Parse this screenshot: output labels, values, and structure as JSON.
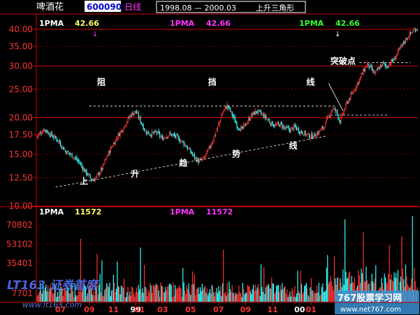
{
  "header": {
    "stock_name": "啤酒花",
    "stock_code": "600090",
    "period": "日线",
    "date_range": "1998.08 — 2000.03",
    "pattern_title": "上升三角形"
  },
  "price_panel": {
    "indicator_labels": [
      {
        "label": "1PMA",
        "value": "42.66",
        "color": "#ffffff"
      },
      {
        "label": "1PMA",
        "value": "42.66",
        "color": "#ff33ff"
      },
      {
        "label": "1PMA",
        "value": "42.66",
        "color": "#33ff33"
      }
    ],
    "annotations": [
      {
        "text": "阻",
        "x": 63,
        "y": 25.9
      },
      {
        "text": "挡",
        "x": 178,
        "y": 25.9
      },
      {
        "text": "线",
        "x": 280,
        "y": 25.9
      },
      {
        "text": "突破点",
        "x": 305,
        "y": 30.5
      },
      {
        "text": "上",
        "x": 45,
        "y": 11.9
      },
      {
        "text": "升",
        "x": 98,
        "y": 12.6
      },
      {
        "text": "趋",
        "x": 148,
        "y": 13.7
      },
      {
        "text": "势",
        "x": 203,
        "y": 14.7
      },
      {
        "text": "线",
        "x": 262,
        "y": 15.7
      }
    ]
  },
  "volume_panel": {
    "indicator_labels": [
      {
        "label": "1PMA",
        "value": "11572",
        "color": "#ffffff"
      },
      {
        "label": "1PMA",
        "value": "11572",
        "color": "#ff33ff"
      }
    ]
  },
  "watermarks": {
    "left_brand": "LT163 证券首席",
    "left_url": "www.lt163.com",
    "right_brand": "767股票学习网",
    "right_url": "www.net767.com"
  },
  "colors": {
    "up": "#ff3333",
    "down": "#33ffff",
    "axis": "#cc0000",
    "tick_text": "#ff3333",
    "resistance_line": "#ffffff",
    "trend_line": "#ffffff"
  },
  "chart_data": [
    {
      "type": "candlestick",
      "title": "",
      "y_scale": "log",
      "ylim": [
        10.0,
        40.0
      ],
      "y_ticks": [
        40.0,
        35.0,
        30.0,
        25.0,
        20.0,
        17.5,
        15.0,
        12.5,
        10.0
      ],
      "x_tick_labels": [
        {
          "label": "07",
          "x": 25
        },
        {
          "label": "09",
          "x": 55
        },
        {
          "label": "11",
          "x": 80
        },
        {
          "label": "99",
          "x": 103
        },
        {
          "label": "01",
          "x": 107
        },
        {
          "label": "03",
          "x": 131
        },
        {
          "label": "05",
          "x": 160
        },
        {
          "label": "07",
          "x": 189
        },
        {
          "label": "09",
          "x": 217
        },
        {
          "label": "11",
          "x": 245
        },
        {
          "label": "00",
          "x": 273
        },
        {
          "label": "01",
          "x": 285
        }
      ],
      "close_path": [
        [
          0,
          17.2
        ],
        [
          8,
          18.3
        ],
        [
          15,
          17.5
        ],
        [
          22,
          16.8
        ],
        [
          30,
          15.4
        ],
        [
          38,
          14.8
        ],
        [
          45,
          14.0
        ],
        [
          50,
          13.2
        ],
        [
          55,
          12.6
        ],
        [
          58,
          12.2
        ],
        [
          62,
          12.5
        ],
        [
          68,
          13.4
        ],
        [
          75,
          15.2
        ],
        [
          82,
          16.8
        ],
        [
          90,
          18.5
        ],
        [
          98,
          20.5
        ],
        [
          103,
          21.0
        ],
        [
          108,
          19.5
        ],
        [
          113,
          18.0
        ],
        [
          118,
          17.6
        ],
        [
          125,
          17.8
        ],
        [
          130,
          17.0
        ],
        [
          138,
          17.6
        ],
        [
          145,
          17.2
        ],
        [
          152,
          16.5
        ],
        [
          158,
          15.6
        ],
        [
          163,
          14.8
        ],
        [
          168,
          14.2
        ],
        [
          173,
          14.4
        ],
        [
          178,
          15.4
        ],
        [
          183,
          16.8
        ],
        [
          188,
          18.5
        ],
        [
          193,
          20.8
        ],
        [
          198,
          22.0
        ],
        [
          203,
          20.5
        ],
        [
          208,
          18.8
        ],
        [
          213,
          18.2
        ],
        [
          218,
          19.2
        ],
        [
          223,
          20.4
        ],
        [
          228,
          21.0
        ],
        [
          233,
          20.6
        ],
        [
          238,
          20.0
        ],
        [
          243,
          19.2
        ],
        [
          248,
          18.8
        ],
        [
          253,
          19.0
        ],
        [
          258,
          18.4
        ],
        [
          263,
          18.2
        ],
        [
          268,
          18.6
        ],
        [
          273,
          18.0
        ],
        [
          278,
          17.7
        ],
        [
          283,
          17.3
        ],
        [
          288,
          17.4
        ],
        [
          293,
          17.9
        ],
        [
          298,
          18.6
        ],
        [
          303,
          20.2
        ],
        [
          307,
          21.5
        ],
        [
          311,
          21.0
        ],
        [
          315,
          19.4
        ],
        [
          319,
          21.2
        ],
        [
          323,
          22.8
        ],
        [
          327,
          24.0
        ],
        [
          331,
          25.5
        ],
        [
          335,
          27.0
        ],
        [
          339,
          28.8
        ],
        [
          343,
          30.4
        ],
        [
          347,
          29.3
        ],
        [
          351,
          28.2
        ],
        [
          355,
          29.4
        ],
        [
          359,
          30.6
        ],
        [
          363,
          29.8
        ],
        [
          367,
          30.8
        ],
        [
          371,
          31.6
        ],
        [
          375,
          33.5
        ],
        [
          379,
          35.2
        ],
        [
          383,
          37.0
        ],
        [
          387,
          38.4
        ],
        [
          391,
          39.6
        ],
        [
          395,
          40.5
        ]
      ],
      "resistance_lines": [
        {
          "x1": 55,
          "x2": 310,
          "value": 21.9
        },
        {
          "x1": 305,
          "x2": 365,
          "value": 20.4
        },
        {
          "x1": 335,
          "x2": 388,
          "value": 30.8
        }
      ],
      "trend_lines": [
        {
          "x1": 20,
          "v1": 11.6,
          "x2": 300,
          "v2": 17.3
        },
        {
          "x1": 303,
          "v1": 26.2,
          "x2": 318,
          "v2": 21.1
        }
      ],
      "breakout_marker_x": 311
    },
    {
      "type": "bar",
      "title": "",
      "ylim": [
        0,
        85000
      ],
      "y_ticks": [
        70802,
        53102,
        35401,
        7701
      ],
      "spikes": [
        {
          "x": 46,
          "value": 58000
        },
        {
          "x": 63,
          "value": 44000
        },
        {
          "x": 68,
          "value": 38000
        },
        {
          "x": 108,
          "value": 50000
        },
        {
          "x": 152,
          "value": 31000
        },
        {
          "x": 194,
          "value": 48000
        },
        {
          "x": 236,
          "value": 32000
        },
        {
          "x": 309,
          "value": 42000
        },
        {
          "x": 320,
          "value": 76000
        },
        {
          "x": 339,
          "value": 64000
        },
        {
          "x": 366,
          "value": 52000
        },
        {
          "x": 379,
          "value": 60000
        },
        {
          "x": 390,
          "value": 79000
        }
      ]
    }
  ]
}
